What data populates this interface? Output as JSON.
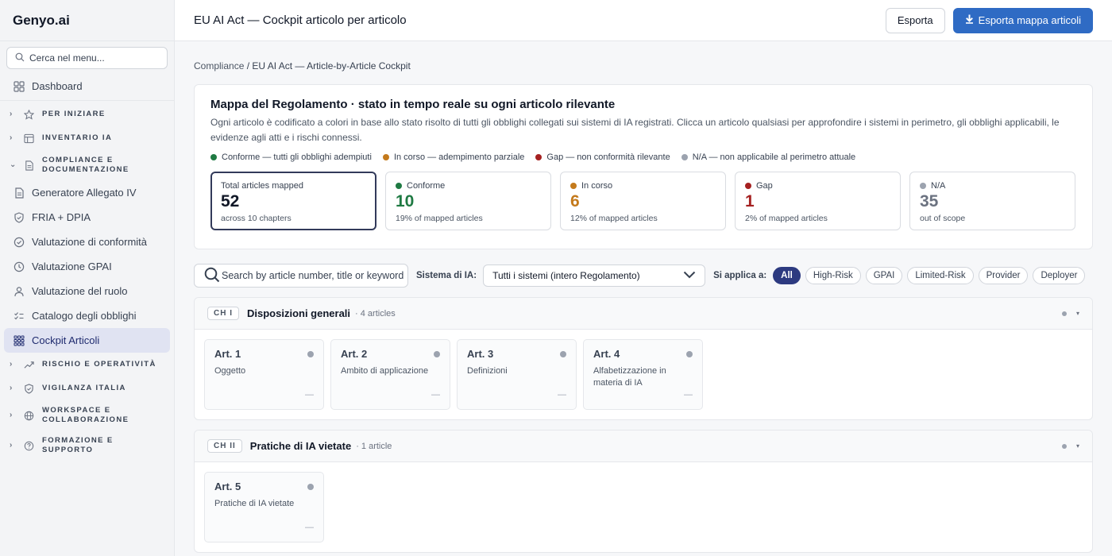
{
  "brand": "Genyo.ai",
  "sidebar": {
    "search_placeholder": "Cerca nel menu...",
    "dashboard": "Dashboard",
    "groups": {
      "per_iniziare": "PER INIZIARE",
      "inventario": "INVENTARIO IA",
      "compliance_l1": "COMPLIANCE E",
      "compliance_l2": "DOCUMENTAZIONE",
      "rischio": "RISCHIO E OPERATIVITÀ",
      "vigilanza": "VIGILANZA ITALIA",
      "workspace_l1": "WORKSPACE E",
      "workspace_l2": "COLLABORAZIONE",
      "formazione_l1": "FORMAZIONE E",
      "formazione_l2": "SUPPORTO"
    },
    "compliance_items": [
      "Generatore Allegato IV",
      "FRIA + DPIA",
      "Valutazione di conformità",
      "Valutazione GPAI",
      "Valutazione del ruolo",
      "Catalogo degli obblighi",
      "Cockpit Articoli"
    ]
  },
  "topbar": {
    "title": "EU AI Act — Cockpit articolo per articolo",
    "export_label": "Esporta",
    "export_map_label": "Esporta mappa articoli"
  },
  "breadcrumb": {
    "root": "Compliance",
    "sep": " / ",
    "current": "EU AI Act — Article-by-Article Cockpit"
  },
  "hero": {
    "title": "Mappa del Regolamento · stato in tempo reale su ogni articolo rilevante",
    "description": "Ogni articolo è codificato a colori in base allo stato risolto di tutti gli obblighi collegati sui sistemi di IA registrati. Clicca un articolo qualsiasi per approfondire i sistemi in perimetro, gli obblighi applicabili, le evidenze agli atti e i rischi connessi.",
    "legend": [
      {
        "label": "Conforme — tutti gli obblighi adempiuti",
        "color": "#1f7a43"
      },
      {
        "label": "In corso — adempimento parziale",
        "color": "#c47a1c"
      },
      {
        "label": "Gap — non conformità rilevante",
        "color": "#a52121"
      },
      {
        "label": "N/A — non applicabile al perimetro attuale",
        "color": "#9ca3af"
      }
    ]
  },
  "stats": [
    {
      "label": "Total articles mapped",
      "value": "52",
      "sub": "across 10 chapters",
      "color": "#111827",
      "dot": ""
    },
    {
      "label": "Conforme",
      "value": "10",
      "sub": "19% of mapped articles",
      "color": "#1f7a43",
      "dot": "#1f7a43"
    },
    {
      "label": "In corso",
      "value": "6",
      "sub": "12% of mapped articles",
      "color": "#c47a1c",
      "dot": "#c47a1c"
    },
    {
      "label": "Gap",
      "value": "1",
      "sub": "2% of mapped articles",
      "color": "#a52121",
      "dot": "#a52121"
    },
    {
      "label": "N/A",
      "value": "35",
      "sub": "out of scope",
      "color": "#6b7280",
      "dot": "#9ca3af"
    }
  ],
  "filters": {
    "search_placeholder": "Search by article number, title or keyword",
    "system_label": "Sistema di IA:",
    "system_value": "Tutti i sistemi (intero Regolamento)",
    "applies_label": "Si applica a:",
    "chips": [
      "All",
      "High-Risk",
      "GPAI",
      "Limited-Risk",
      "Provider",
      "Deployer"
    ]
  },
  "chapters": [
    {
      "badge": "CH I",
      "title": "Disposizioni generali",
      "count": "· 4 articles",
      "articles": [
        {
          "num": "Art. 1",
          "desc": "Oggetto",
          "mark": "—"
        },
        {
          "num": "Art. 2",
          "desc": "Ambito di applicazione",
          "mark": "—"
        },
        {
          "num": "Art. 3",
          "desc": "Definizioni",
          "mark": "—"
        },
        {
          "num": "Art. 4",
          "desc": "Alfabetizzazione in materia di IA",
          "mark": "—"
        }
      ]
    },
    {
      "badge": "CH II",
      "title": "Pratiche di IA vietate",
      "count": "· 1 article",
      "articles": [
        {
          "num": "Art. 5",
          "desc": "Pratiche di IA vietate",
          "mark": "—"
        }
      ]
    }
  ],
  "colors": {
    "accent": "#2f6bc4",
    "active_nav": "#e0e3f2",
    "chip_active": "#2d3a80",
    "na_dot": "#9ca3af"
  }
}
